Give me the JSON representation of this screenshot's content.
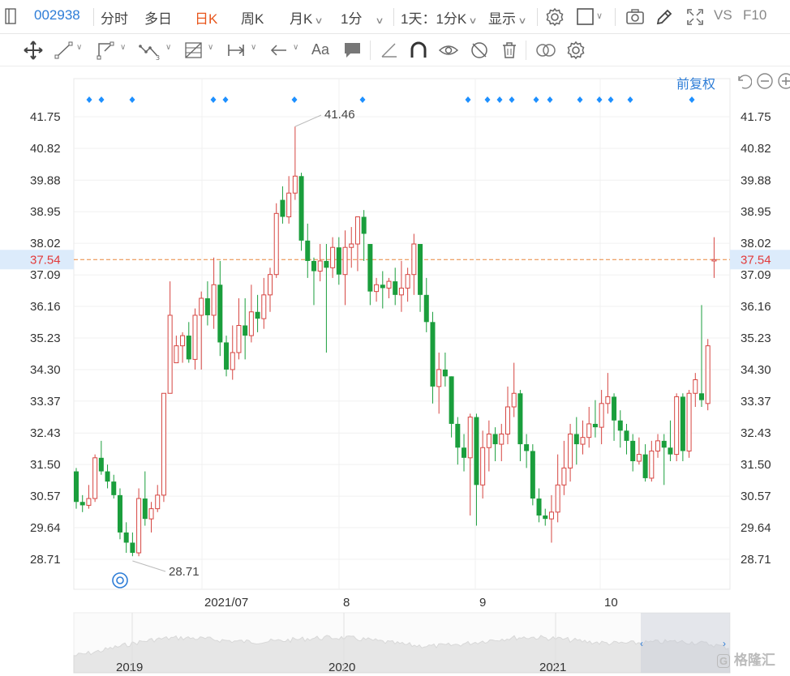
{
  "topbar": {
    "stock_code": "002938",
    "tabs": [
      {
        "label": "分时",
        "active": false,
        "chevron": false
      },
      {
        "label": "多日",
        "active": false,
        "chevron": false
      },
      {
        "label": "日K",
        "active": true,
        "chevron": false
      },
      {
        "label": "周K",
        "active": false,
        "chevron": false
      },
      {
        "label": "月K",
        "active": false,
        "chevron": true
      },
      {
        "label": "1分",
        "active": false,
        "chevron": true
      },
      {
        "label": "1天：1分K",
        "active": false,
        "chevron": true
      },
      {
        "label": "显示",
        "active": false,
        "chevron": true
      }
    ],
    "compare_label": "VS",
    "f10_label": "F10"
  },
  "toolbar": {
    "tools": [
      "crosshair-icon",
      "line-icon",
      "polyline-icon",
      "wave-icon",
      "fibonacci-icon",
      "range-icon",
      "arrow-icon",
      "text-icon",
      "comment-icon",
      "ruler-icon",
      "magnet-icon",
      "eye-icon",
      "hide-icon",
      "trash-icon",
      "overlay-icon",
      "settings-icon"
    ],
    "text_tool_label": "Aa"
  },
  "chart_controls": {
    "adjust_label": "前复权"
  },
  "chart_data": {
    "type": "candlestick",
    "y_ticks": [
      "41.75",
      "40.82",
      "39.88",
      "38.95",
      "38.02",
      "37.09",
      "36.16",
      "35.23",
      "34.30",
      "33.37",
      "32.43",
      "31.50",
      "30.57",
      "29.64",
      "28.71"
    ],
    "ylim": [
      28.0,
      42.5
    ],
    "x_ticks": [
      "2021/07",
      "8",
      "9",
      "10"
    ],
    "current_price": "37.54",
    "current_price_value": 37.54,
    "max_label": "41.46",
    "max_value": 41.46,
    "min_label": "28.71",
    "min_value": 28.71,
    "up_color": "#d64541",
    "down_color": "#1a9e3c",
    "candles": [
      [
        31.3,
        30.4,
        31.4,
        30.2
      ],
      [
        30.4,
        30.3,
        30.6,
        30.1
      ],
      [
        30.3,
        30.5,
        30.9,
        30.2
      ],
      [
        30.5,
        31.7,
        31.8,
        30.4
      ],
      [
        31.7,
        31.3,
        32.2,
        31.2
      ],
      [
        31.3,
        31.0,
        31.5,
        30.8
      ],
      [
        31.0,
        30.6,
        31.2,
        30.5
      ],
      [
        30.6,
        29.5,
        30.8,
        29.3
      ],
      [
        29.5,
        29.2,
        29.8,
        28.9
      ],
      [
        29.2,
        28.9,
        29.5,
        28.8
      ],
      [
        28.9,
        30.5,
        30.8,
        28.8
      ],
      [
        30.5,
        29.9,
        31.3,
        29.7
      ],
      [
        29.9,
        30.2,
        30.4,
        29.5
      ],
      [
        30.2,
        30.6,
        30.9,
        30.1
      ],
      [
        30.6,
        33.6,
        33.6,
        30.4
      ],
      [
        33.6,
        35.9,
        36.9,
        33.6
      ],
      [
        34.5,
        35.0,
        35.3,
        34.5
      ],
      [
        35.0,
        35.3,
        35.4,
        34.5
      ],
      [
        35.3,
        34.6,
        35.7,
        34.5
      ],
      [
        34.6,
        35.9,
        36.1,
        34.3
      ],
      [
        35.9,
        36.4,
        36.6,
        34.3
      ],
      [
        36.4,
        35.9,
        36.9,
        35.6
      ],
      [
        35.9,
        36.8,
        37.6,
        35.5
      ],
      [
        36.8,
        35.1,
        37.5,
        34.7
      ],
      [
        35.1,
        34.3,
        35.3,
        34.1
      ],
      [
        34.3,
        34.8,
        35.6,
        34.0
      ],
      [
        34.8,
        35.6,
        36.4,
        34.6
      ],
      [
        35.6,
        35.3,
        36.4,
        34.6
      ],
      [
        35.3,
        36.0,
        36.8,
        35.1
      ],
      [
        36.0,
        35.8,
        36.5,
        35.4
      ],
      [
        35.8,
        36.5,
        37.0,
        35.5
      ],
      [
        36.5,
        37.1,
        37.3,
        36.0
      ],
      [
        37.1,
        38.9,
        39.2,
        37.0
      ],
      [
        39.3,
        38.8,
        39.7,
        38.6
      ],
      [
        38.8,
        39.5,
        40.0,
        38.6
      ],
      [
        39.5,
        40.0,
        41.46,
        39.3
      ],
      [
        40.0,
        38.1,
        40.1,
        37.8
      ],
      [
        38.1,
        37.5,
        38.6,
        37.0
      ],
      [
        37.5,
        37.2,
        37.6,
        36.2
      ],
      [
        37.2,
        37.5,
        38.0,
        36.9
      ],
      [
        37.5,
        37.3,
        38.0,
        34.8
      ],
      [
        37.3,
        37.9,
        38.2,
        37.0
      ],
      [
        37.9,
        37.1,
        38.2,
        36.8
      ],
      [
        37.1,
        37.9,
        38.4,
        36.2
      ],
      [
        37.9,
        38.0,
        38.5,
        37.3
      ],
      [
        38.0,
        38.8,
        38.8,
        37.2
      ],
      [
        38.8,
        38.3,
        39.0,
        37.5
      ],
      [
        38.0,
        36.6,
        38.0,
        36.2
      ],
      [
        36.6,
        36.8,
        37.0,
        36.3
      ],
      [
        36.8,
        36.7,
        37.2,
        36.1
      ],
      [
        36.7,
        36.9,
        37.0,
        36.4
      ],
      [
        36.9,
        36.5,
        37.3,
        36.2
      ],
      [
        36.5,
        36.7,
        37.5,
        36.0
      ],
      [
        36.7,
        37.1,
        37.3,
        36.3
      ],
      [
        37.1,
        38.0,
        38.3,
        36.5
      ],
      [
        38.0,
        36.5,
        38.0,
        36.0
      ],
      [
        36.5,
        35.7,
        37.0,
        35.4
      ],
      [
        35.7,
        33.8,
        36.0,
        33.3
      ],
      [
        33.8,
        34.3,
        34.8,
        33.0
      ],
      [
        34.3,
        34.1,
        34.8,
        33.8
      ],
      [
        34.1,
        32.7,
        34.1,
        32.3
      ],
      [
        32.7,
        32.0,
        32.9,
        31.5
      ],
      [
        32.0,
        31.7,
        32.4,
        31.3
      ],
      [
        31.7,
        32.9,
        33.0,
        30.0
      ],
      [
        32.9,
        30.9,
        33.0,
        29.7
      ],
      [
        30.9,
        32.0,
        32.5,
        30.5
      ],
      [
        32.0,
        32.4,
        32.8,
        31.3
      ],
      [
        32.4,
        32.1,
        32.6,
        31.6
      ],
      [
        32.1,
        32.4,
        32.7,
        31.6
      ],
      [
        32.4,
        33.2,
        33.8,
        32.1
      ],
      [
        33.2,
        33.6,
        34.5,
        32.9
      ],
      [
        33.6,
        32.1,
        33.7,
        31.6
      ],
      [
        32.1,
        31.9,
        32.4,
        31.4
      ],
      [
        31.9,
        30.5,
        32.1,
        30.3
      ],
      [
        30.5,
        30.0,
        30.8,
        29.8
      ],
      [
        30.0,
        29.9,
        30.2,
        29.7
      ],
      [
        29.9,
        30.1,
        30.6,
        29.2
      ],
      [
        30.1,
        30.9,
        31.8,
        29.8
      ],
      [
        30.9,
        31.4,
        32.2,
        30.6
      ],
      [
        31.4,
        32.4,
        32.7,
        31.0
      ],
      [
        32.4,
        32.1,
        32.9,
        31.5
      ],
      [
        32.1,
        32.3,
        32.8,
        31.8
      ],
      [
        32.3,
        32.7,
        33.2,
        32.0
      ],
      [
        32.7,
        32.6,
        33.4,
        32.3
      ],
      [
        32.6,
        33.3,
        33.7,
        32.1
      ],
      [
        33.3,
        33.5,
        34.2,
        33.0
      ],
      [
        33.5,
        32.8,
        33.6,
        32.2
      ],
      [
        32.8,
        32.5,
        33.1,
        32.0
      ],
      [
        32.5,
        32.2,
        32.7,
        31.8
      ],
      [
        32.2,
        31.6,
        32.4,
        31.3
      ],
      [
        31.6,
        31.8,
        32.3,
        31.5
      ],
      [
        31.8,
        31.1,
        32.1,
        31.0
      ],
      [
        31.1,
        31.9,
        32.2,
        31.0
      ],
      [
        31.9,
        32.2,
        32.4,
        31.7
      ],
      [
        32.2,
        32.0,
        32.4,
        30.9
      ],
      [
        32.0,
        31.8,
        32.8,
        31.6
      ],
      [
        31.8,
        33.5,
        33.6,
        31.6
      ],
      [
        33.5,
        31.9,
        33.6,
        31.6
      ],
      [
        31.9,
        33.6,
        33.7,
        31.7
      ],
      [
        33.6,
        34.0,
        34.2,
        33.2
      ],
      [
        33.6,
        33.4,
        36.2,
        33.2
      ],
      [
        33.3,
        35.0,
        35.2,
        33.1
      ],
      [
        37.5,
        37.54,
        38.2,
        37.0
      ]
    ],
    "markers": [
      110,
      125,
      163,
      263,
      278,
      363,
      447,
      577,
      601,
      616,
      631,
      661,
      678,
      715,
      739,
      753,
      777,
      853
    ],
    "navigator_labels": [
      "2019",
      "2020",
      "2021"
    ]
  },
  "colors": {
    "accent": "#2e7dd7",
    "active_tab": "#e8561c",
    "marker": "#1e90ff",
    "price_line": "#e8863a",
    "price_text": "#e23a3a",
    "price_band": "#dcebfb"
  },
  "watermark": "格隆汇"
}
